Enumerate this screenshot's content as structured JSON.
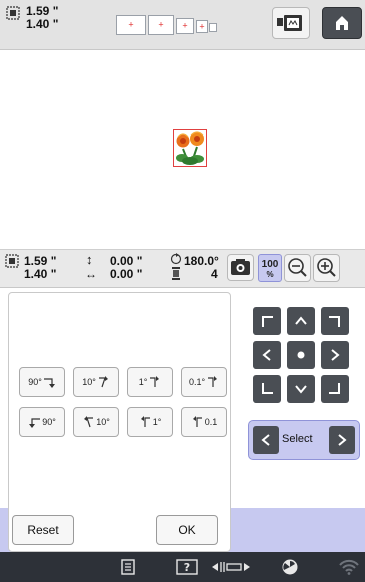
{
  "top": {
    "width": "1.59 \"",
    "height": "1.40 \""
  },
  "info": {
    "width": "1.59 \"",
    "height": "1.40 \"",
    "offset_v": "0.00 \"",
    "offset_h": "0.00 \"",
    "rotation": "180.0°",
    "color_count": "4",
    "zoom": "100",
    "zoom_unit": "%"
  },
  "rotate": {
    "cw90": "90°",
    "cw10": "10°",
    "cw1": "1°",
    "cw01": "0.1°",
    "ccw90": "90°",
    "ccw10": "10°",
    "ccw1": "1°",
    "ccw01": "0.1"
  },
  "buttons": {
    "reset": "Reset",
    "ok": "OK",
    "select": "Select"
  }
}
